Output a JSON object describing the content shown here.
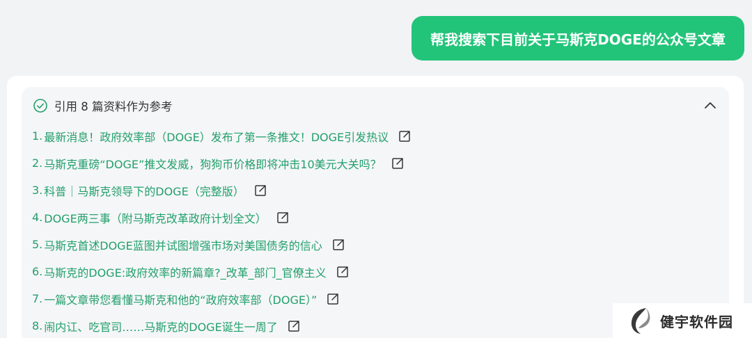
{
  "user_message": "帮我搜索下目前关于马斯克DOGE的公众号文章",
  "references": {
    "title": "引用 8 篇资料作为参考",
    "items": [
      {
        "num": "1.",
        "text": "最新消息！政府效率部（DOGE）发布了第一条推文！DOGE引发热议"
      },
      {
        "num": "2.",
        "text": "马斯克重磅“DOGE”推文发威，狗狗币价格即将冲击10美元大关吗？"
      },
      {
        "num": "3.",
        "text": "科普｜马斯克领导下的DOGE（完整版）"
      },
      {
        "num": "4.",
        "text": "DOGE两三事（附马斯克改革政府计划全文）"
      },
      {
        "num": "5.",
        "text": "马斯克首述DOGE蓝图并试图增强市场对美国债务的信心"
      },
      {
        "num": "6.",
        "text": "马斯克的DOGE:政府效率的新篇章?_改革_部门_官僚主义"
      },
      {
        "num": "7.",
        "text": "一篇文章带您看懂马斯克和他的“政府效率部（DOGE）”"
      },
      {
        "num": "8.",
        "text": "闹内讧、吃官司……马斯克的DOGE诞生一周了"
      }
    ]
  },
  "watermark": {
    "text": "健宇软件园"
  },
  "colors": {
    "accent": "#22c47a",
    "link": "#22a06b",
    "panel": "#f5f6f8",
    "page": "#f2f3f5"
  },
  "icons": {
    "check": "check-circle-icon",
    "collapse": "chevron-up-icon",
    "external": "external-link-icon"
  }
}
